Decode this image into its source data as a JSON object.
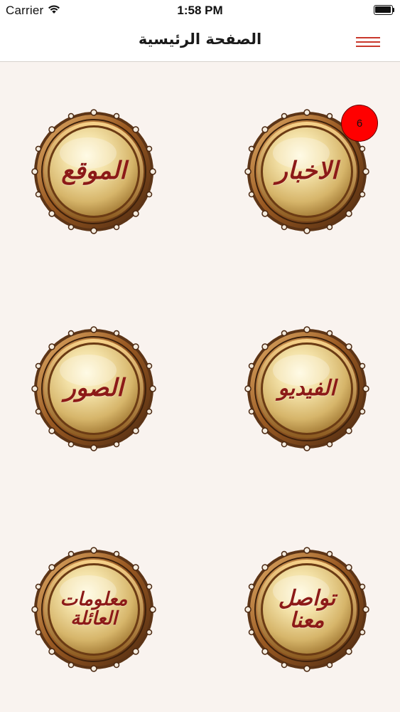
{
  "status_bar": {
    "carrier": "Carrier",
    "time": "1:58 PM"
  },
  "nav": {
    "title": "الصفحة الرئيسية",
    "menu_icon": "hamburger-menu-icon",
    "accent_color": "#c9382c"
  },
  "tiles": [
    {
      "label": "الاخبار",
      "badge": "6"
    },
    {
      "label": "الموقع"
    },
    {
      "label": "الفيديو"
    },
    {
      "label": "الصور"
    },
    {
      "label": "تواصل معنا"
    },
    {
      "label": "معلومات\nالعائلة"
    }
  ],
  "colors": {
    "background": "#f9f3ef",
    "label_color": "#8c1a18",
    "badge_color": "#ff0000"
  }
}
